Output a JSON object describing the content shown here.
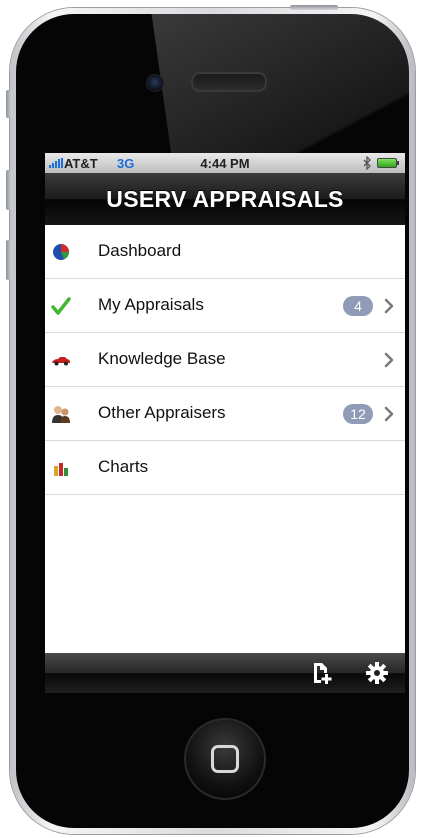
{
  "status_bar": {
    "carrier": "AT&T",
    "network": "3G",
    "time": "4:44 PM"
  },
  "header": {
    "title": "USERV APPRAISALS"
  },
  "menu": {
    "items": [
      {
        "label": "Dashboard",
        "icon": "pie-chart-icon",
        "badge": "",
        "has_chevron": false
      },
      {
        "label": "My Appraisals",
        "icon": "checkmark-icon",
        "badge": "4",
        "has_chevron": true
      },
      {
        "label": "Knowledge Base",
        "icon": "car-icon",
        "badge": "",
        "has_chevron": true
      },
      {
        "label": "Other Appraisers",
        "icon": "people-icon",
        "badge": "12",
        "has_chevron": true
      },
      {
        "label": "Charts",
        "icon": "bar-chart-icon",
        "badge": "",
        "has_chevron": false
      }
    ]
  },
  "toolbar": {
    "left_icon": "new-document-icon",
    "right_icon": "gear-icon"
  },
  "colors": {
    "badge": "#8f9bb7",
    "network_blue": "#1a6fd8",
    "check_green": "#3fb82e"
  }
}
